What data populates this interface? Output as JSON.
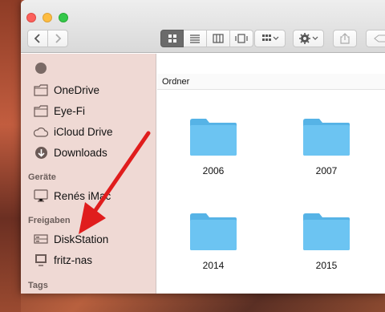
{
  "sidebar": {
    "favorites": [
      {
        "label": "OneDrive",
        "icon": "folder-icon"
      },
      {
        "label": "Eye-Fi",
        "icon": "folder-icon"
      },
      {
        "label": "iCloud Drive",
        "icon": "cloud-icon"
      },
      {
        "label": "Downloads",
        "icon": "download-icon"
      }
    ],
    "devices_header": "Geräte",
    "devices": [
      {
        "label": "Renés iMac",
        "icon": "imac-icon"
      }
    ],
    "shared_header": "Freigaben",
    "shared": [
      {
        "label": "DiskStation",
        "icon": "server-icon"
      },
      {
        "label": "fritz-nas",
        "icon": "monitor-icon"
      }
    ],
    "tags_header": "Tags"
  },
  "content": {
    "header": "Ordner",
    "folders": [
      {
        "name": "2006"
      },
      {
        "name": "2007"
      },
      {
        "name": "2014"
      },
      {
        "name": "2015"
      }
    ]
  },
  "colors": {
    "folder": "#6cc4f2",
    "folder_tab": "#56b3e6",
    "sidebar_bg": "#efd9d4",
    "arrow": "#e01d1d"
  }
}
